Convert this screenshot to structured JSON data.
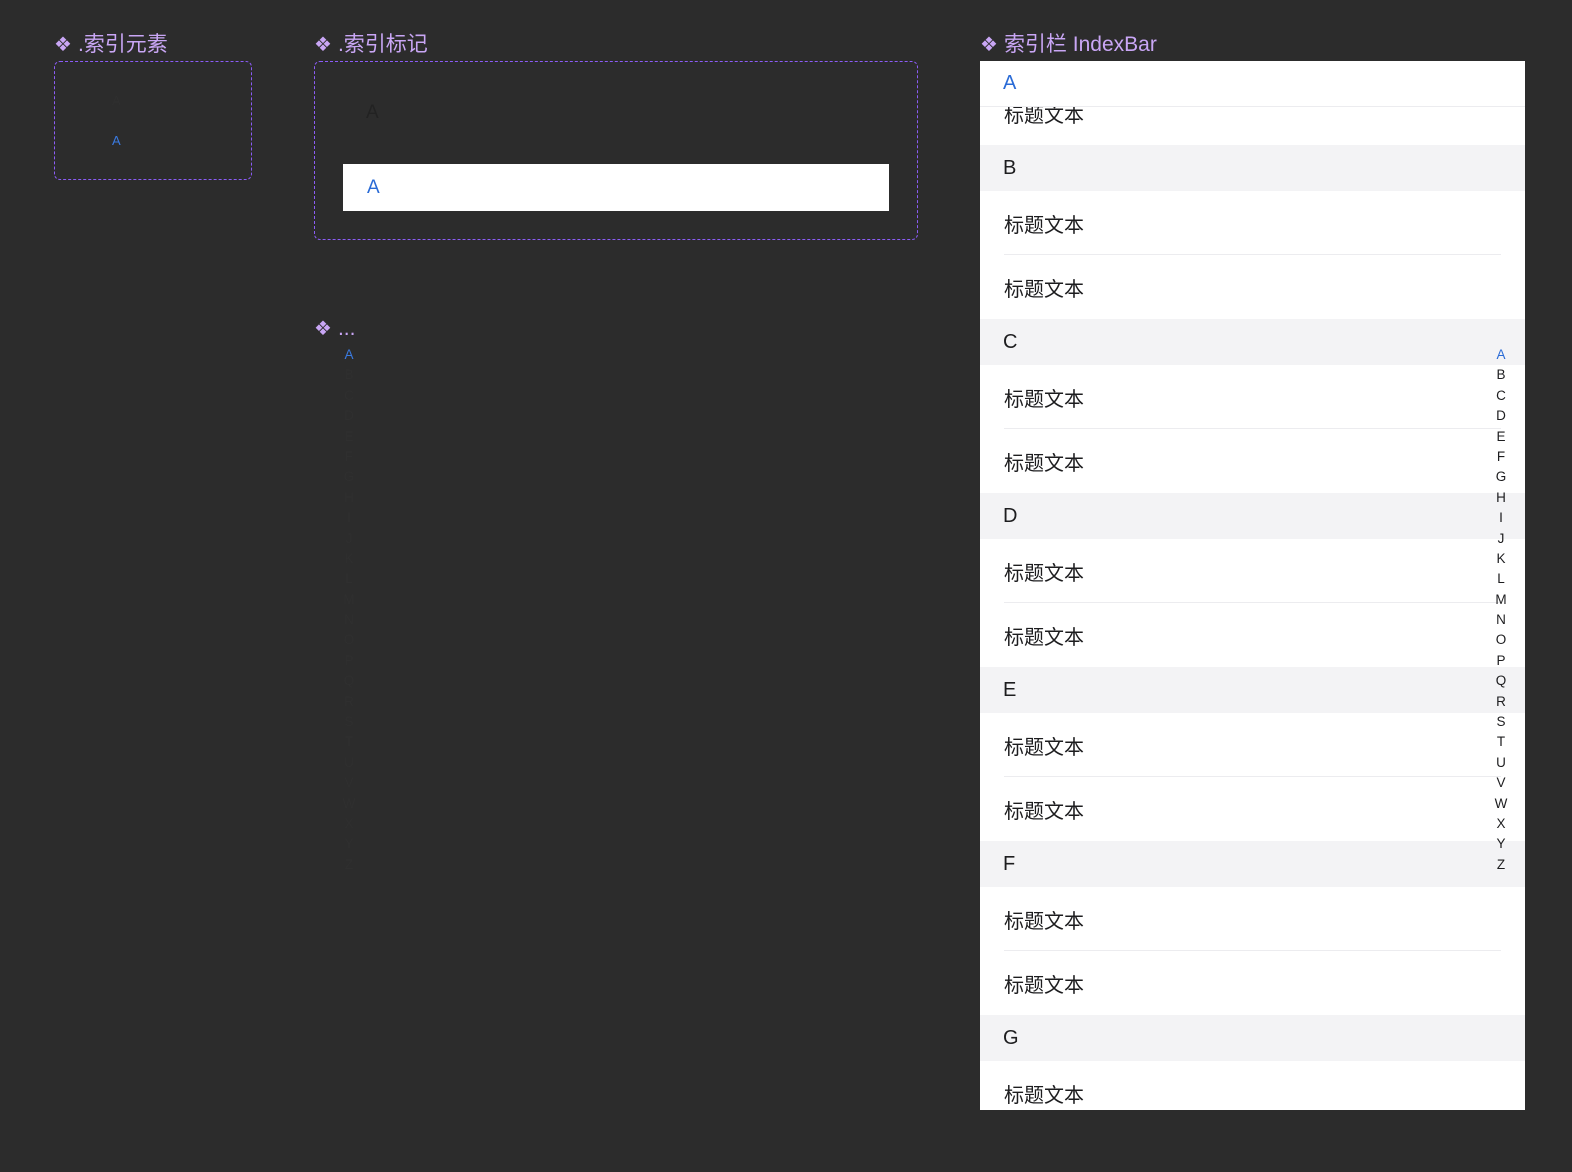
{
  "colors": {
    "background": "#2c2c2c",
    "component_title": "#c9a6f5",
    "dashed_border": "#8b5cf6",
    "accent": "#2a6bd6",
    "text_dark": "#1d1d1f",
    "group_header_bg": "#f3f3f5"
  },
  "icons": {
    "component": "component-diamond-icon"
  },
  "diamond_glyph": "❖",
  "index_element": {
    "title": ".索引元素",
    "default_letter": "A",
    "active_letter": "A"
  },
  "index_marker": {
    "title": ".索引标记",
    "default_letter": "A",
    "active_letter": "A"
  },
  "index_column": {
    "title": "...",
    "active": "A",
    "letters": [
      "A",
      "B",
      "C",
      "D",
      "E",
      "F",
      "G",
      "H",
      "I",
      "J",
      "K",
      "L",
      "M",
      "N",
      "O",
      "P",
      "Q",
      "R",
      "S",
      "T",
      "U",
      "V",
      "W",
      "X",
      "Y",
      "Z"
    ]
  },
  "indexbar": {
    "title": "索引栏 IndexBar",
    "sticky_header": "A",
    "groups": [
      {
        "letter": "A",
        "items": [
          "标题文本"
        ]
      },
      {
        "letter": "B",
        "items": [
          "标题文本",
          "标题文本"
        ]
      },
      {
        "letter": "C",
        "items": [
          "标题文本",
          "标题文本"
        ]
      },
      {
        "letter": "D",
        "items": [
          "标题文本",
          "标题文本"
        ]
      },
      {
        "letter": "E",
        "items": [
          "标题文本",
          "标题文本"
        ]
      },
      {
        "letter": "F",
        "items": [
          "标题文本",
          "标题文本"
        ]
      },
      {
        "letter": "G",
        "items": [
          "标题文本"
        ]
      }
    ],
    "side_active": "A",
    "side_letters": [
      "A",
      "B",
      "C",
      "D",
      "E",
      "F",
      "G",
      "H",
      "I",
      "J",
      "K",
      "L",
      "M",
      "N",
      "O",
      "P",
      "Q",
      "R",
      "S",
      "T",
      "U",
      "V",
      "W",
      "X",
      "Y",
      "Z"
    ]
  }
}
